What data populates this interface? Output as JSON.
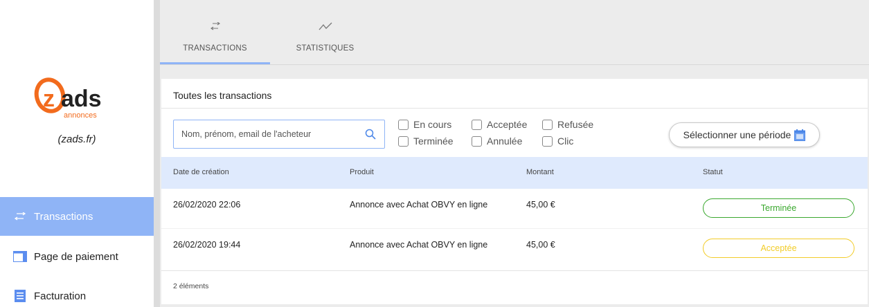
{
  "brand": {
    "logo_text": "zads",
    "logo_subtext": "annonces",
    "caption": "(zads.fr)",
    "colors": {
      "orange": "#f26b1d",
      "dark": "#222222"
    }
  },
  "sidebar": {
    "items": [
      {
        "label": "Transactions",
        "icon": "arrows-swap-icon",
        "active": true
      },
      {
        "label": "Page de paiement",
        "icon": "window-icon",
        "active": false
      },
      {
        "label": "Facturation",
        "icon": "document-lines-icon",
        "active": false
      }
    ]
  },
  "tabs": [
    {
      "label": "TRANSACTIONS",
      "icon": "arrows-swap-icon",
      "active": true
    },
    {
      "label": "STATISTIQUES",
      "icon": "line-chart-icon",
      "active": false
    }
  ],
  "card": {
    "title": "Toutes les transactions"
  },
  "search": {
    "placeholder": "Nom, prénom, email de l'acheteur",
    "value": ""
  },
  "filters": [
    {
      "label": "En cours",
      "checked": false
    },
    {
      "label": "Terminée",
      "checked": false
    },
    {
      "label": "Acceptée",
      "checked": false
    },
    {
      "label": "Annulée",
      "checked": false
    },
    {
      "label": "Refusée",
      "checked": false
    },
    {
      "label": "Clic",
      "checked": false
    }
  ],
  "period_button": {
    "label": "Sélectionner une période"
  },
  "table": {
    "columns": [
      "Date de création",
      "Produit",
      "Montant",
      "Statut"
    ],
    "rows": [
      {
        "date": "26/02/2020 22:06",
        "product": "Annonce avec Achat OBVY en ligne",
        "amount": "45,00 €",
        "status": "Terminée"
      },
      {
        "date": "26/02/2020 19:44",
        "product": "Annonce avec Achat OBVY en ligne",
        "amount": "45,00 €",
        "status": "Acceptée"
      }
    ],
    "count": "2 éléments"
  },
  "colors": {
    "accent": "#8fb4f6",
    "table_header": "#dfeafd",
    "status_done": "#3aa82e",
    "status_accepted": "#f2cc28"
  }
}
